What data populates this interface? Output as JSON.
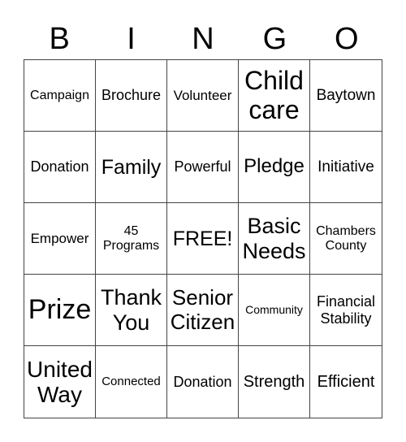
{
  "header": [
    "B",
    "I",
    "N",
    "G",
    "O"
  ],
  "cells": [
    "Campaign",
    "Brochure",
    "Volunteer",
    "Child care",
    "Baytown",
    "Donation",
    "Family",
    "Powerful",
    "Pledge",
    "Initiative",
    "Empower",
    "45 Programs",
    "FREE!",
    "Basic Needs",
    "Chambers County",
    "Prize",
    "Thank You",
    "Senior Citizen",
    "Community",
    "Financial Stability",
    "United Way",
    "Connected",
    "Donation",
    "Strength",
    "Efficient"
  ]
}
